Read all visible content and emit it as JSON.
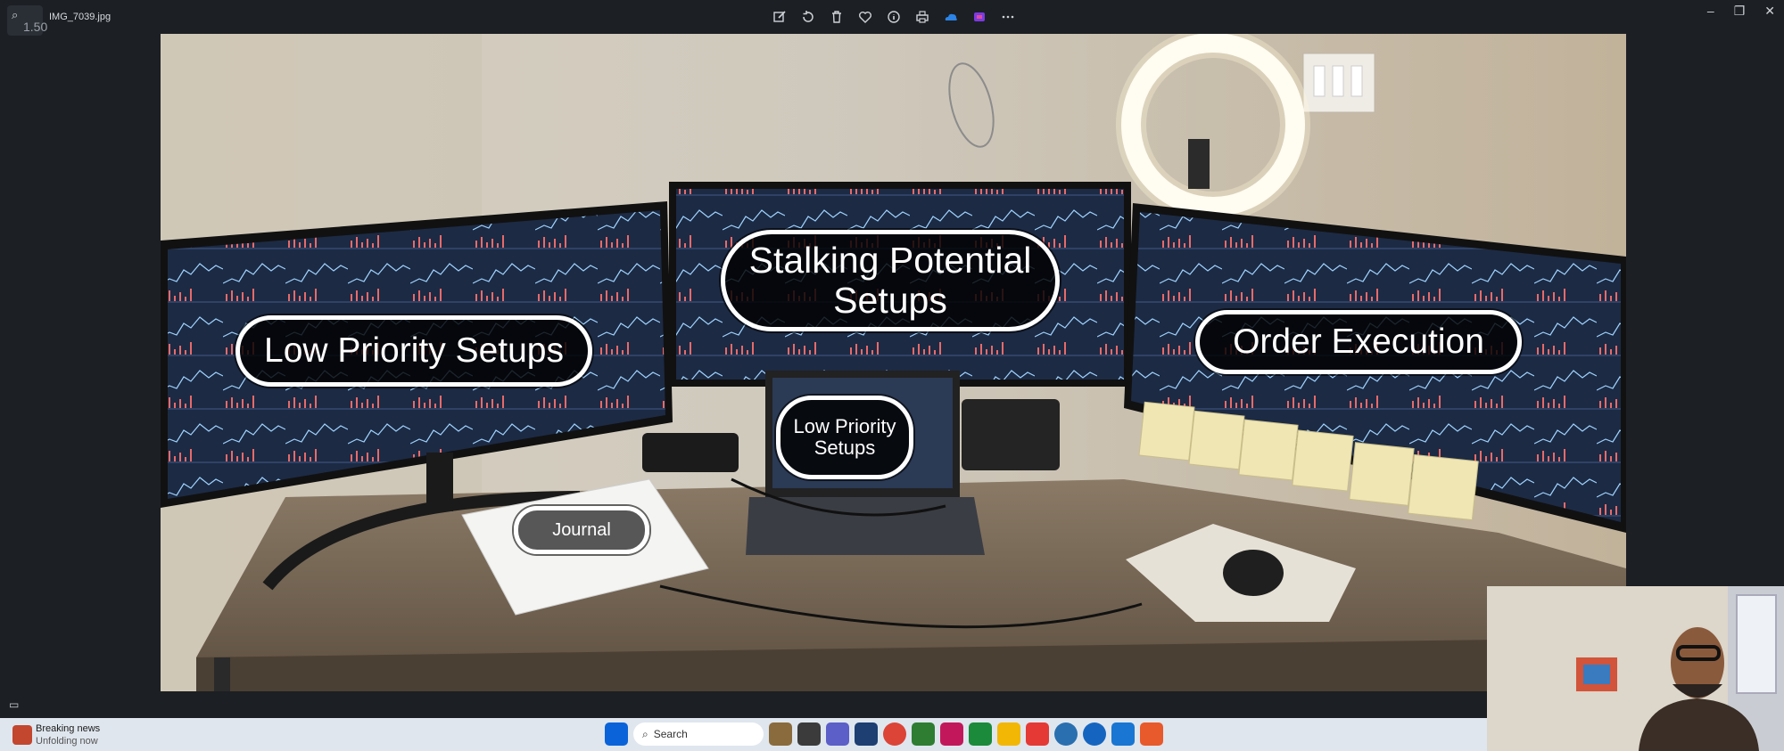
{
  "viewer": {
    "zoom_label": "1.50",
    "file_name": "IMG_7039.jpg",
    "toolbar": [
      "edit-icon",
      "rotate-icon",
      "delete-icon",
      "favorite-icon",
      "info-icon",
      "print-icon",
      "onedrive-icon",
      "clipchamp-icon",
      "more-icon"
    ],
    "window_controls": {
      "minimize": "–",
      "maximize": "❐",
      "close": "✕"
    }
  },
  "photo": {
    "labels": {
      "low_priority_left": "Low Priority Setups",
      "stalking": "Stalking Potential Setups",
      "order_execution": "Order Execution",
      "low_priority_laptop": "Low Priority Setups",
      "journal": "Journal"
    }
  },
  "taskbar": {
    "news_title": "Breaking news",
    "news_subtitle": "Unfolding now",
    "search_placeholder": "Search",
    "apps": [
      "start-icon",
      "search",
      "copilot-icon",
      "file-manager-icon",
      "teams-icon",
      "visual-studio-icon",
      "chrome-icon",
      "app-icon",
      "app-icon",
      "app-icon",
      "explorer-icon",
      "app-icon",
      "app-icon",
      "app-icon",
      "app-icon",
      "app-icon"
    ]
  },
  "colors": {
    "overlay_border": "#ffffff",
    "overlay_fill": "#000000",
    "taskbar": "#dfe6ee",
    "app_bg": "#1c1f24"
  }
}
